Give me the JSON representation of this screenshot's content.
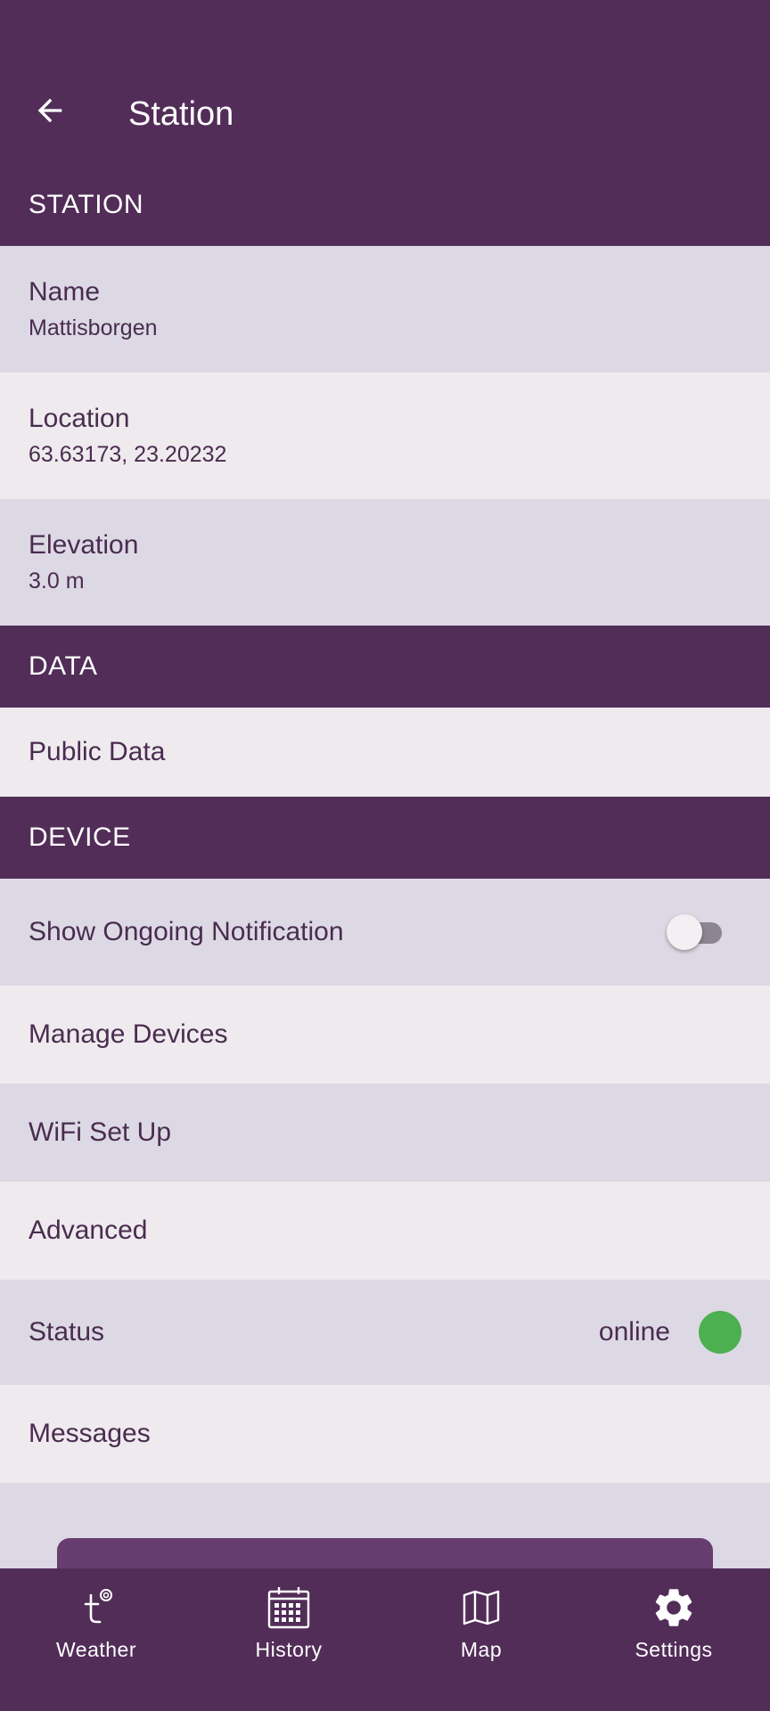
{
  "app_bar": {
    "title": "Station",
    "back_icon": "arrow-left-icon"
  },
  "sections": {
    "station": {
      "header": "STATION",
      "items": [
        {
          "title": "Name",
          "value": "Mattisborgen"
        },
        {
          "title": "Location",
          "value": "63.63173, 23.20232"
        },
        {
          "title": "Elevation",
          "value": "3.0 m"
        }
      ]
    },
    "data": {
      "header": "DATA",
      "items": [
        {
          "title": "Public Data"
        }
      ]
    },
    "device": {
      "header": "DEVICE",
      "items": [
        {
          "title": "Show Ongoing Notification",
          "toggle_on": false
        },
        {
          "title": "Manage Devices"
        },
        {
          "title": "WiFi Set Up"
        },
        {
          "title": "Advanced"
        },
        {
          "title": "Status",
          "value": "online",
          "status_color": "#4caf50"
        },
        {
          "title": "Messages"
        }
      ]
    }
  },
  "bottom_nav": {
    "items": [
      {
        "label": "Weather",
        "icon": "tempest-logo-icon"
      },
      {
        "label": "History",
        "icon": "calendar-icon"
      },
      {
        "label": "Map",
        "icon": "map-icon"
      },
      {
        "label": "Settings",
        "icon": "gear-icon",
        "active": true
      }
    ]
  },
  "colors": {
    "primary": "#522d58",
    "row_dark": "#dcd9e5",
    "row_light": "#eeeaee",
    "text": "#4a2c4f",
    "status_online": "#4caf50"
  }
}
